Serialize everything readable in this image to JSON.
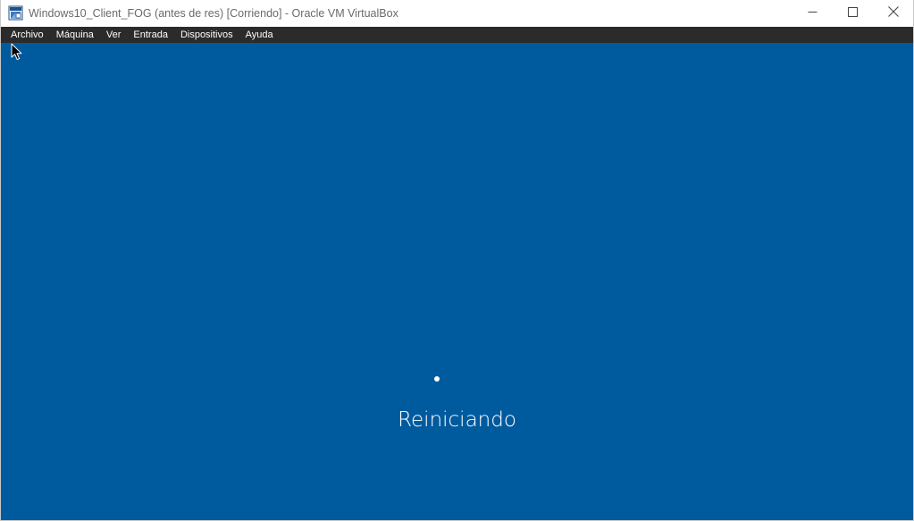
{
  "window": {
    "title": "Windows10_Client_FOG (antes de res) [Corriendo] - Oracle VM VirtualBox",
    "icon": "virtualbox-vm-icon",
    "controls": {
      "minimize_icon": "minimize-icon",
      "maximize_icon": "maximize-icon",
      "close_icon": "close-icon"
    }
  },
  "menubar": {
    "items": [
      {
        "label": "Archivo"
      },
      {
        "label": "Máquina"
      },
      {
        "label": "Ver"
      },
      {
        "label": "Entrada"
      },
      {
        "label": "Dispositivos"
      },
      {
        "label": "Ayuda"
      }
    ]
  },
  "vm_screen": {
    "background_color": "#005a9e",
    "status_text": "Reiniciando",
    "spinner_icon": "loading-dot-icon"
  },
  "cursor": {
    "icon": "mouse-pointer-icon"
  }
}
